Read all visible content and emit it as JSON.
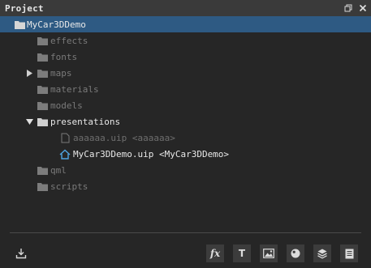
{
  "panel": {
    "title": "Project"
  },
  "tree": {
    "root": {
      "label": "MyCar3DDemo"
    },
    "items": [
      {
        "label": "effects"
      },
      {
        "label": "fonts"
      },
      {
        "label": "maps"
      },
      {
        "label": "materials"
      },
      {
        "label": "models"
      },
      {
        "label": "presentations"
      },
      {
        "label": "aaaaaa.uip <aaaaaa>"
      },
      {
        "label": "MyCar3DDemo.uip <MyCar3DDemo>"
      },
      {
        "label": "qml"
      },
      {
        "label": "scripts"
      }
    ]
  },
  "toolbar": {
    "effect_label": "fx",
    "text_label": "T"
  },
  "colors": {
    "selection": "#2e5a83",
    "background": "#262626",
    "titlebar": "#3a3a3a",
    "folder": "#8a8a8a",
    "folder_bright": "#d0d0d0",
    "home_icon": "#4fa3e0"
  },
  "icons": {
    "float": "float-window-icon",
    "close": "close-icon",
    "import": "import-icon",
    "folder": "folder-icon",
    "file": "file-icon",
    "home": "home-icon",
    "image": "image-icon",
    "material": "material-sphere-icon",
    "layers": "layers-icon",
    "document": "document-icon"
  }
}
